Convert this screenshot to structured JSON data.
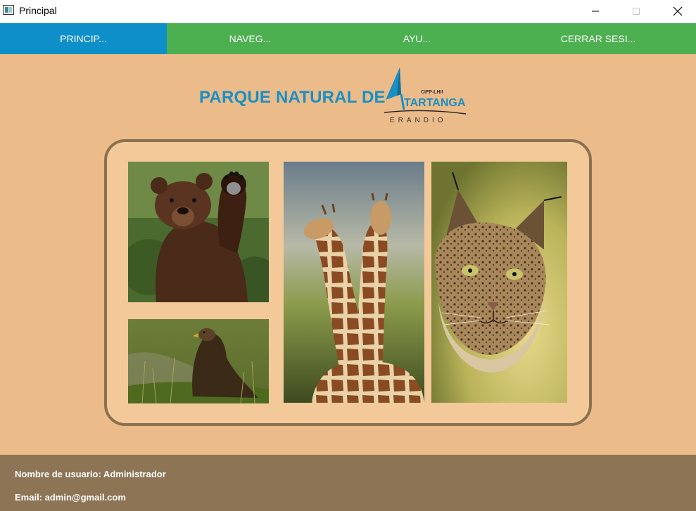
{
  "window": {
    "title": "Principal"
  },
  "nav": {
    "items": [
      {
        "label": "PRINCIP...",
        "active": true
      },
      {
        "label": "NAVEG...",
        "active": false
      },
      {
        "label": "AYU...",
        "active": false
      },
      {
        "label": "CERRAR SESI...",
        "active": false
      }
    ]
  },
  "header": {
    "title": "PARQUE NATURAL DE",
    "logo": {
      "top_text": "CIFP-LHII",
      "name": "TARTANGA",
      "subtitle": "ERANDIO"
    }
  },
  "gallery": {
    "photos": [
      {
        "name": "bear-photo"
      },
      {
        "name": "eagle-photo"
      },
      {
        "name": "giraffes-photo"
      },
      {
        "name": "lynx-photo"
      }
    ]
  },
  "footer": {
    "username_line": "Nombre de usuario: Administrador",
    "email_line": "Email: admin@gmail.com"
  },
  "colors": {
    "background": "#ebbb8a",
    "nav_green": "#4caf50",
    "nav_active": "#0f8fc9",
    "title_blue": "#1a8fc4",
    "gallery_border": "#8a7150",
    "footer": "#8c7455"
  }
}
